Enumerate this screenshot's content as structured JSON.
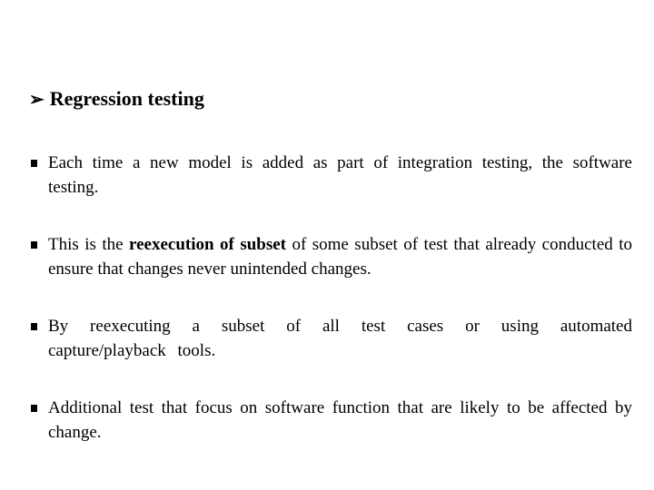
{
  "slide": {
    "heading": {
      "icon": "arrow-bullet-icon",
      "arrow_glyph": "➢",
      "text": "Regression testing"
    },
    "bullets": [
      {
        "icon": "square-bullet-icon",
        "before": "Each time a new model is added as part of integration testing, the software testing.",
        "bold": "",
        "after": ""
      },
      {
        "icon": "square-bullet-icon",
        "before": "This is the ",
        "bold": "reexecution of subset",
        "after": " of some subset of test that already conducted to ensure that changes never unintended changes."
      },
      {
        "icon": "square-bullet-icon",
        "before": "By reexecuting a subset of all test cases or using automated capture/playback tools.",
        "bold": "",
        "after": ""
      },
      {
        "icon": "square-bullet-icon",
        "before": "Additional test that focus on software function that are likely to  be affected by change.",
        "bold": "",
        "after": ""
      }
    ]
  }
}
